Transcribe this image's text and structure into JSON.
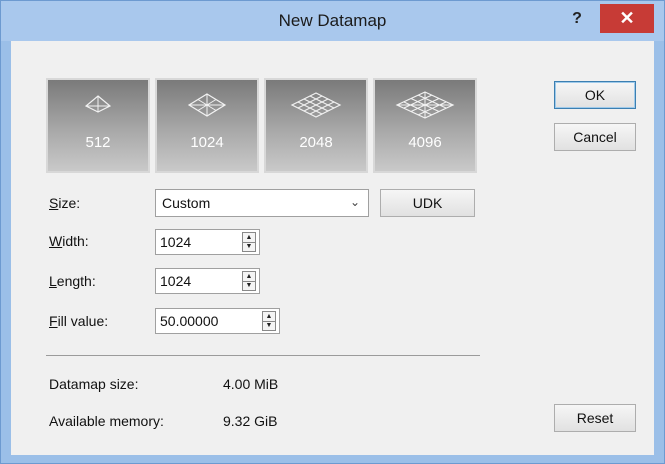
{
  "window": {
    "title": "New Datamap",
    "help_label": "?",
    "close_label": "✕"
  },
  "presets": [
    {
      "label": "512",
      "icon": "terrain-small-icon"
    },
    {
      "label": "1024",
      "icon": "terrain-medium-icon"
    },
    {
      "label": "2048",
      "icon": "terrain-large-icon"
    },
    {
      "label": "4096",
      "icon": "terrain-xlarge-icon"
    }
  ],
  "form": {
    "size_label_key": "S",
    "size_label_rest": "ize:",
    "size_value": "Custom",
    "udk_label": "UDK",
    "width_label_key": "W",
    "width_label_rest": "idth:",
    "width_value": "1024",
    "length_label_key": "L",
    "length_label_rest": "ength:",
    "length_value": "1024",
    "fill_label_key": "F",
    "fill_label_rest": "ill value:",
    "fill_value": "50.00000"
  },
  "info": {
    "datamap_size_label": "Datamap size:",
    "datamap_size_value": "4.00 MiB",
    "memory_label": "Available memory:",
    "memory_value": "9.32 GiB"
  },
  "buttons": {
    "ok": "OK",
    "cancel": "Cancel",
    "reset": "Reset"
  },
  "colors": {
    "titlebar": "#a9c8ed",
    "close": "#c73b36",
    "tile_top": "#7a7a7a",
    "tile_bottom": "#c9c9c9"
  }
}
